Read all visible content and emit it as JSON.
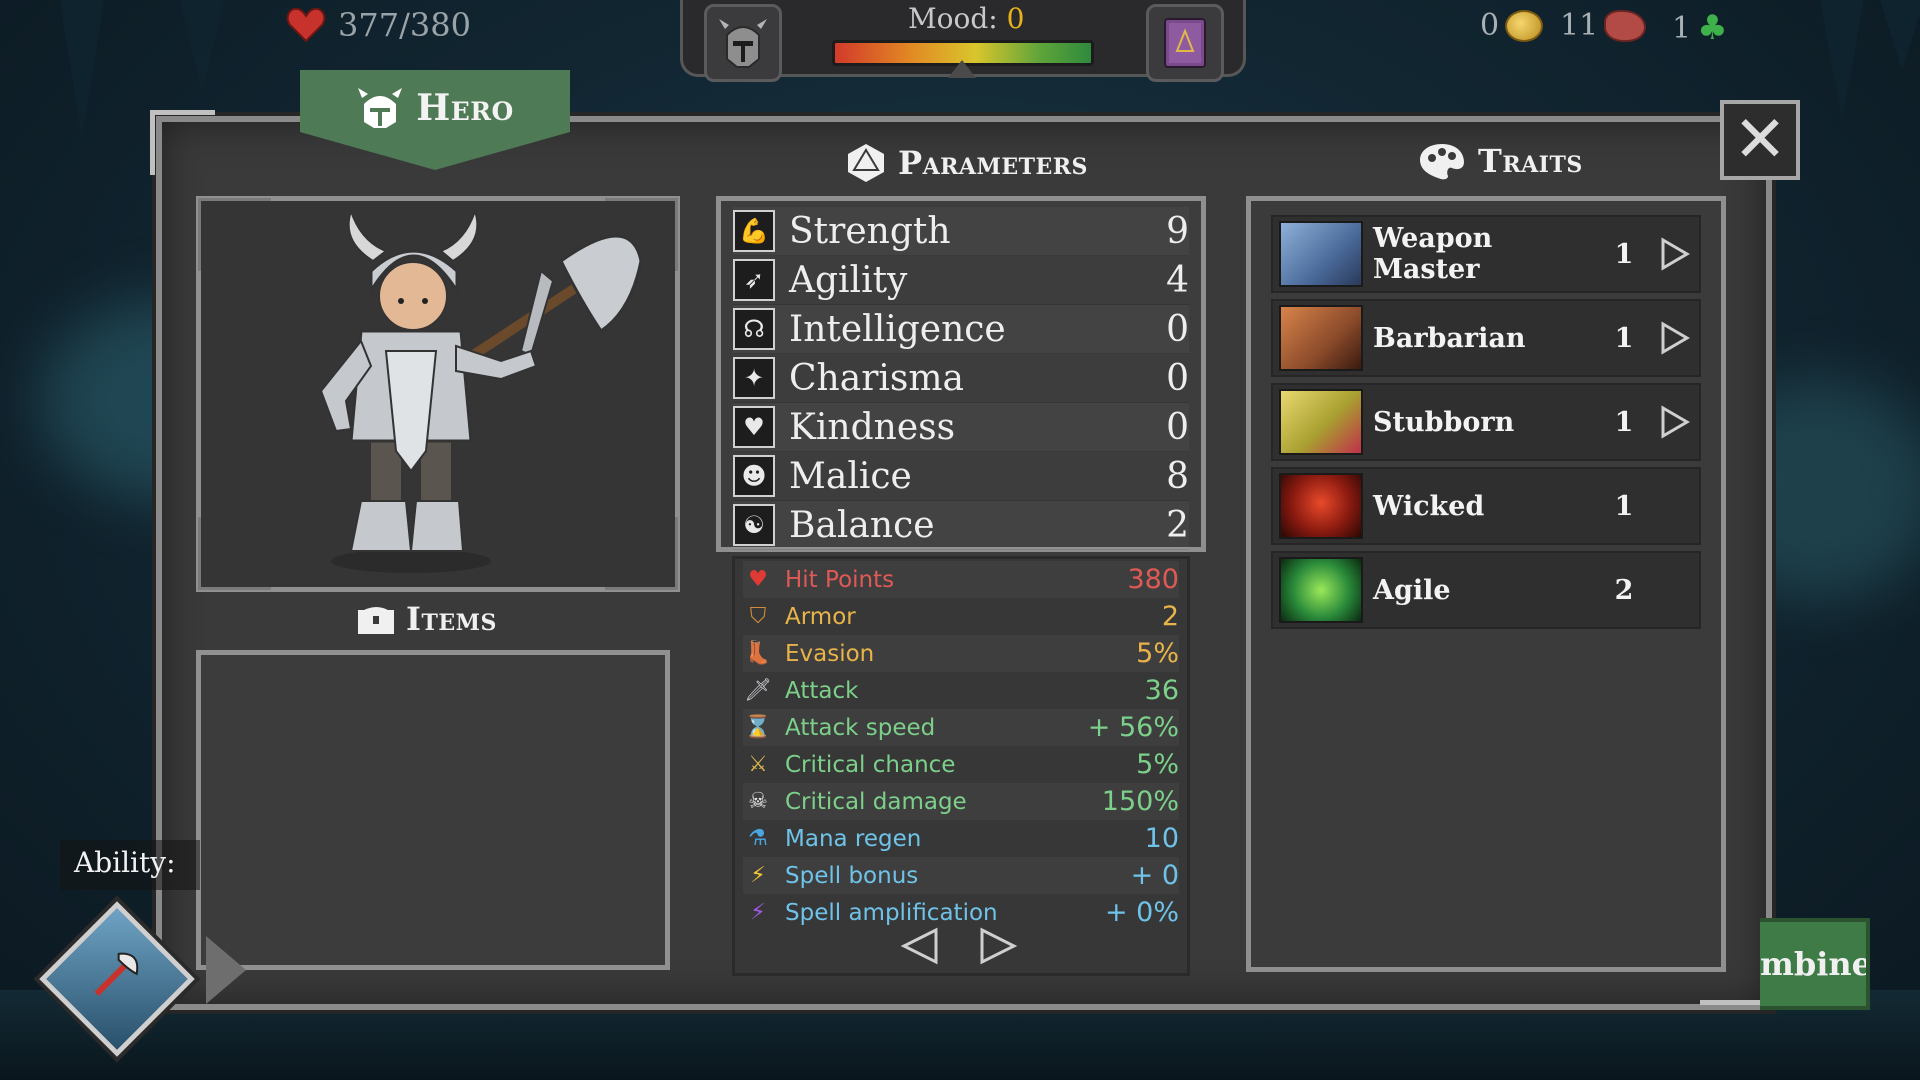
{
  "hud": {
    "hp": "377/380",
    "mood_label": "Mood:",
    "mood_value": "0",
    "gold": "0",
    "meat": "11",
    "clover": "1"
  },
  "hero_tab": {
    "label": "Hero"
  },
  "items": {
    "header": "Items"
  },
  "ability": {
    "label": "Ability:"
  },
  "parameters": {
    "header": "Parameters",
    "rows": [
      {
        "name": "Strength",
        "value": "9",
        "icon": "strength-icon"
      },
      {
        "name": "Agility",
        "value": "4",
        "icon": "agility-icon"
      },
      {
        "name": "Intelligence",
        "value": "0",
        "icon": "intelligence-icon"
      },
      {
        "name": "Charisma",
        "value": "0",
        "icon": "charisma-icon"
      },
      {
        "name": "Kindness",
        "value": "0",
        "icon": "kindness-icon"
      },
      {
        "name": "Malice",
        "value": "8",
        "icon": "malice-icon"
      },
      {
        "name": "Balance",
        "value": "2",
        "icon": "balance-icon"
      }
    ]
  },
  "stats": [
    {
      "name": "Hit Points",
      "value": "380",
      "color": "#e05a55",
      "icon": "heart-icon"
    },
    {
      "name": "Armor",
      "value": "2",
      "color": "#e8b44a",
      "icon": "shield-icon"
    },
    {
      "name": "Evasion",
      "value": "5%",
      "color": "#e8b44a",
      "icon": "boot-icon"
    },
    {
      "name": "Attack",
      "value": "36",
      "color": "#7cd08a",
      "icon": "sword-icon"
    },
    {
      "name": "Attack speed",
      "value": "+ 56%",
      "color": "#7cd08a",
      "icon": "hourglass-icon"
    },
    {
      "name": "Critical chance",
      "value": "5%",
      "color": "#7cd08a",
      "icon": "crossed-swords-icon"
    },
    {
      "name": "Critical damage",
      "value": "150%",
      "color": "#7cd08a",
      "icon": "skull-icon"
    },
    {
      "name": "Mana regen",
      "value": "10",
      "color": "#6fc3e8",
      "icon": "potion-icon"
    },
    {
      "name": "Spell bonus",
      "value": "+ 0",
      "color": "#6fc3e8",
      "icon": "lightning-icon"
    },
    {
      "name": "Spell amplification",
      "value": "+ 0%",
      "color": "#6fc3e8",
      "icon": "purple-lightning-icon"
    }
  ],
  "traits": {
    "header": "Traits",
    "rows": [
      {
        "name": "Weapon Master",
        "level": "1",
        "has_arrow": true,
        "img_color": "#4a6a9a"
      },
      {
        "name": "Barbarian",
        "level": "1",
        "has_arrow": true,
        "img_color": "#8a4a2a"
      },
      {
        "name": "Stubborn",
        "level": "1",
        "has_arrow": true,
        "img_color": "#a8a030"
      },
      {
        "name": "Wicked",
        "level": "1",
        "has_arrow": false,
        "img_color": "#8a1a10"
      },
      {
        "name": "Agile",
        "level": "2",
        "has_arrow": false,
        "img_color": "#2a8a3a"
      }
    ]
  },
  "combine": {
    "label": "mbine"
  }
}
